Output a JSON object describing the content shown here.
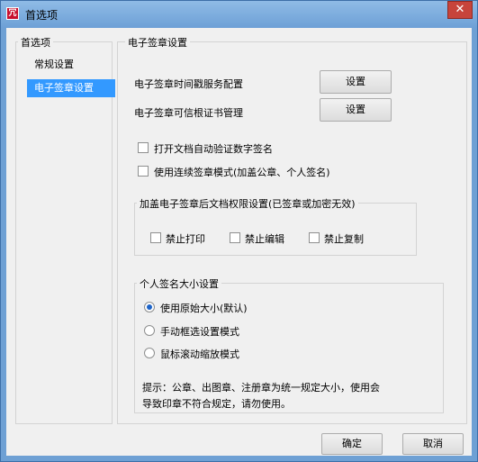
{
  "window": {
    "title": "首选项",
    "app_icon_glyph": "冗"
  },
  "nav": {
    "legend": "首选项",
    "items": [
      {
        "label": "常规设置",
        "selected": false
      },
      {
        "label": "电子签章设置",
        "selected": true
      }
    ]
  },
  "settings": {
    "legend": "电子签章设置",
    "timestamp_label": "电子签章时间戳服务配置",
    "timestamp_button": "设置",
    "cert_label": "电子签章可信根证书管理",
    "cert_button": "设置",
    "auto_verify_label": "打开文档自动验证数字签名",
    "auto_verify_checked": false,
    "continuous_label": "使用连续签章模式(加盖公章、个人签名)",
    "continuous_checked": false
  },
  "permissions": {
    "legend": "加盖电子签章后文档权限设置(已签章或加密无效)",
    "items": [
      {
        "label": "禁止打印",
        "checked": false
      },
      {
        "label": "禁止编辑",
        "checked": false
      },
      {
        "label": "禁止复制",
        "checked": false
      }
    ]
  },
  "signature_size": {
    "legend": "个人签名大小设置",
    "options": [
      {
        "label": "使用原始大小(默认)",
        "selected": true
      },
      {
        "label": "手动框选设置模式",
        "selected": false
      },
      {
        "label": "鼠标滚动缩放模式",
        "selected": false
      }
    ],
    "hint_line1": "提示：公章、出图章、注册章为统一规定大小，使用会",
    "hint_line2": "导致印章不符合规定，请勿使用。"
  },
  "footer": {
    "ok": "确定",
    "cancel": "取消"
  },
  "colors": {
    "titlebar": "#6da0d6",
    "selected_nav": "#3399ff",
    "radio_dot": "#1e64c8",
    "close": "#c7443b"
  }
}
